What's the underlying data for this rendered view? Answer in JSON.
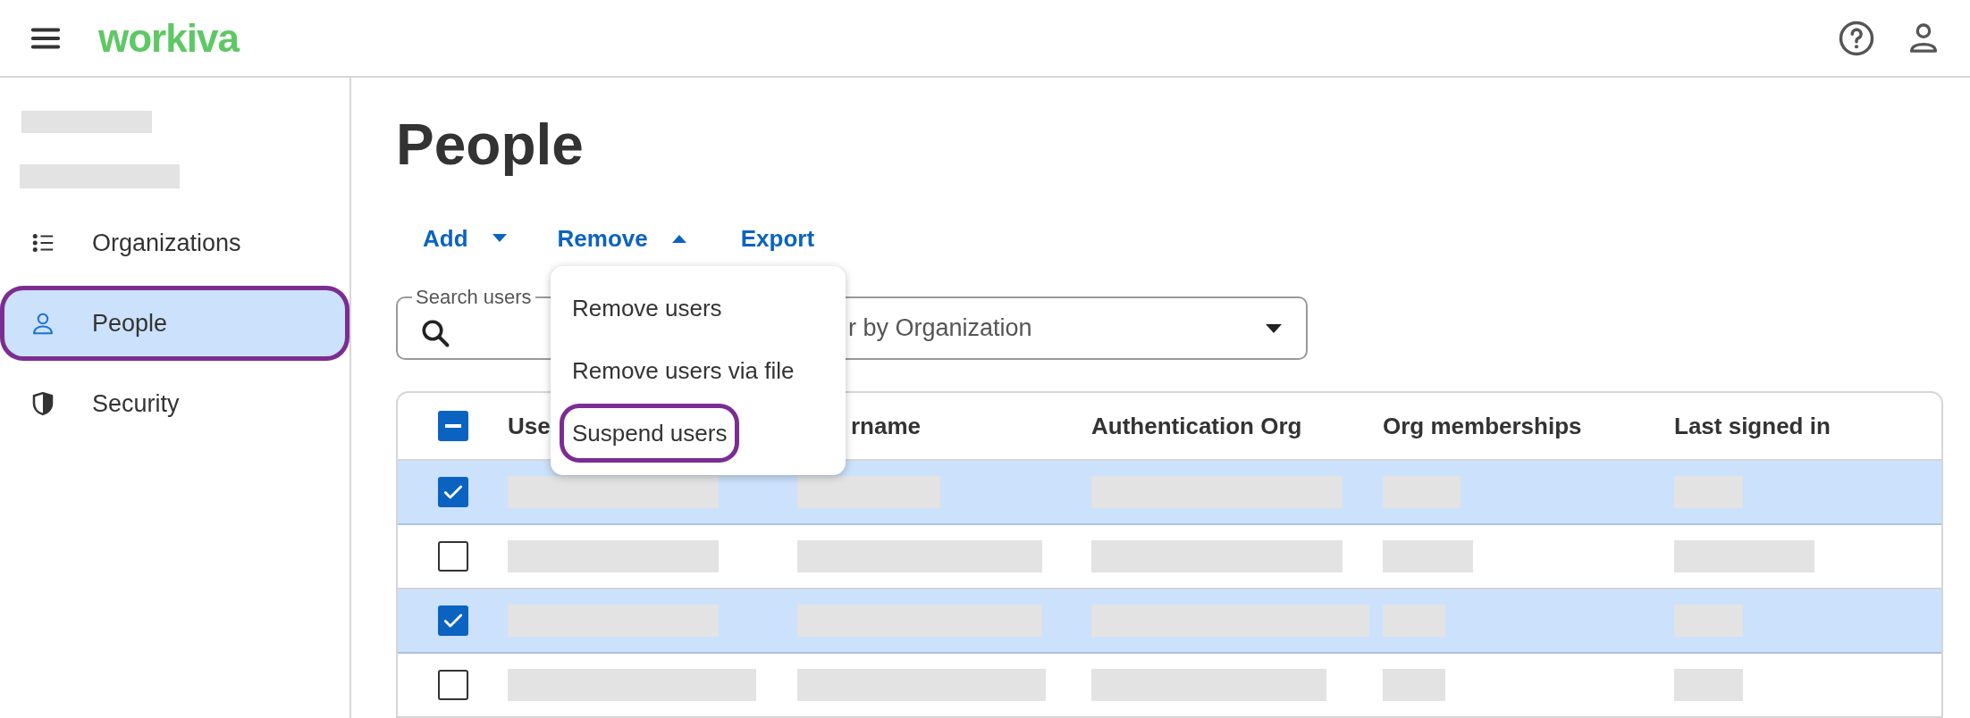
{
  "header": {
    "logo": "workiva"
  },
  "sidebar": {
    "items": [
      {
        "label": "Organizations",
        "selected": false,
        "highlighted": false
      },
      {
        "label": "People",
        "selected": true,
        "highlighted": true
      },
      {
        "label": "Security",
        "selected": false,
        "highlighted": false
      }
    ]
  },
  "page_title": "People",
  "actions": [
    {
      "label": "Add",
      "kind": "dropdown",
      "expanded": false
    },
    {
      "label": "Remove",
      "kind": "dropdown",
      "expanded": true
    },
    {
      "label": "Export",
      "kind": "link"
    }
  ],
  "search": {
    "label": "Search users"
  },
  "filter": {
    "placeholder": "r by Organization"
  },
  "menu": {
    "items": [
      {
        "label": "Remove users",
        "highlighted": false
      },
      {
        "label": "Remove users via file",
        "highlighted": false
      },
      {
        "label": "Suspend users",
        "highlighted": true
      }
    ]
  },
  "table": {
    "select_all": {
      "partial": true
    },
    "columns": [
      "Use",
      "rname",
      "Authentication Org",
      "Org memberships",
      "Last signed in"
    ],
    "rows": [
      {
        "selected": true
      },
      {
        "selected": false
      },
      {
        "selected": true
      },
      {
        "selected": false
      }
    ]
  }
}
